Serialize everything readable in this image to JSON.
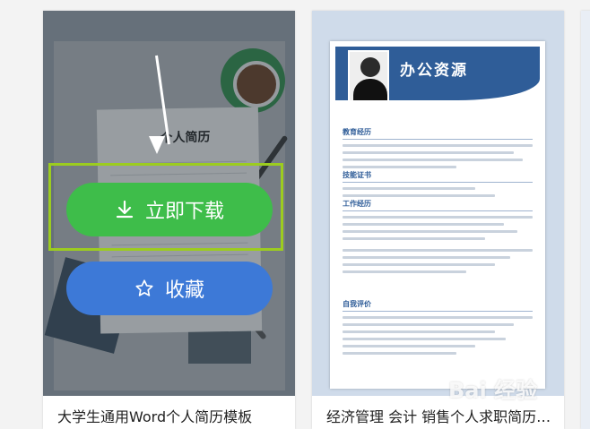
{
  "cards": [
    {
      "title": "大学生通用Word个人简历模板",
      "preview_heading": "个人简历",
      "actions": {
        "download_label": "立即下载",
        "favorite_label": "收藏"
      }
    },
    {
      "title": "经济管理 会计 销售个人求职简历…",
      "preview_heading": "办公资源",
      "preview_sections": [
        "教育经历",
        "技能证书",
        "工作经历",
        "自我评价"
      ]
    }
  ],
  "watermark": "Bai 经验",
  "colors": {
    "download_button": "#3ebd4a",
    "favorite_button": "#3d79d7",
    "highlight_border": "#9ccc1f",
    "resume_accent": "#2f5d98"
  },
  "icons": {
    "download": "download-icon",
    "favorite": "star-outline-icon"
  }
}
